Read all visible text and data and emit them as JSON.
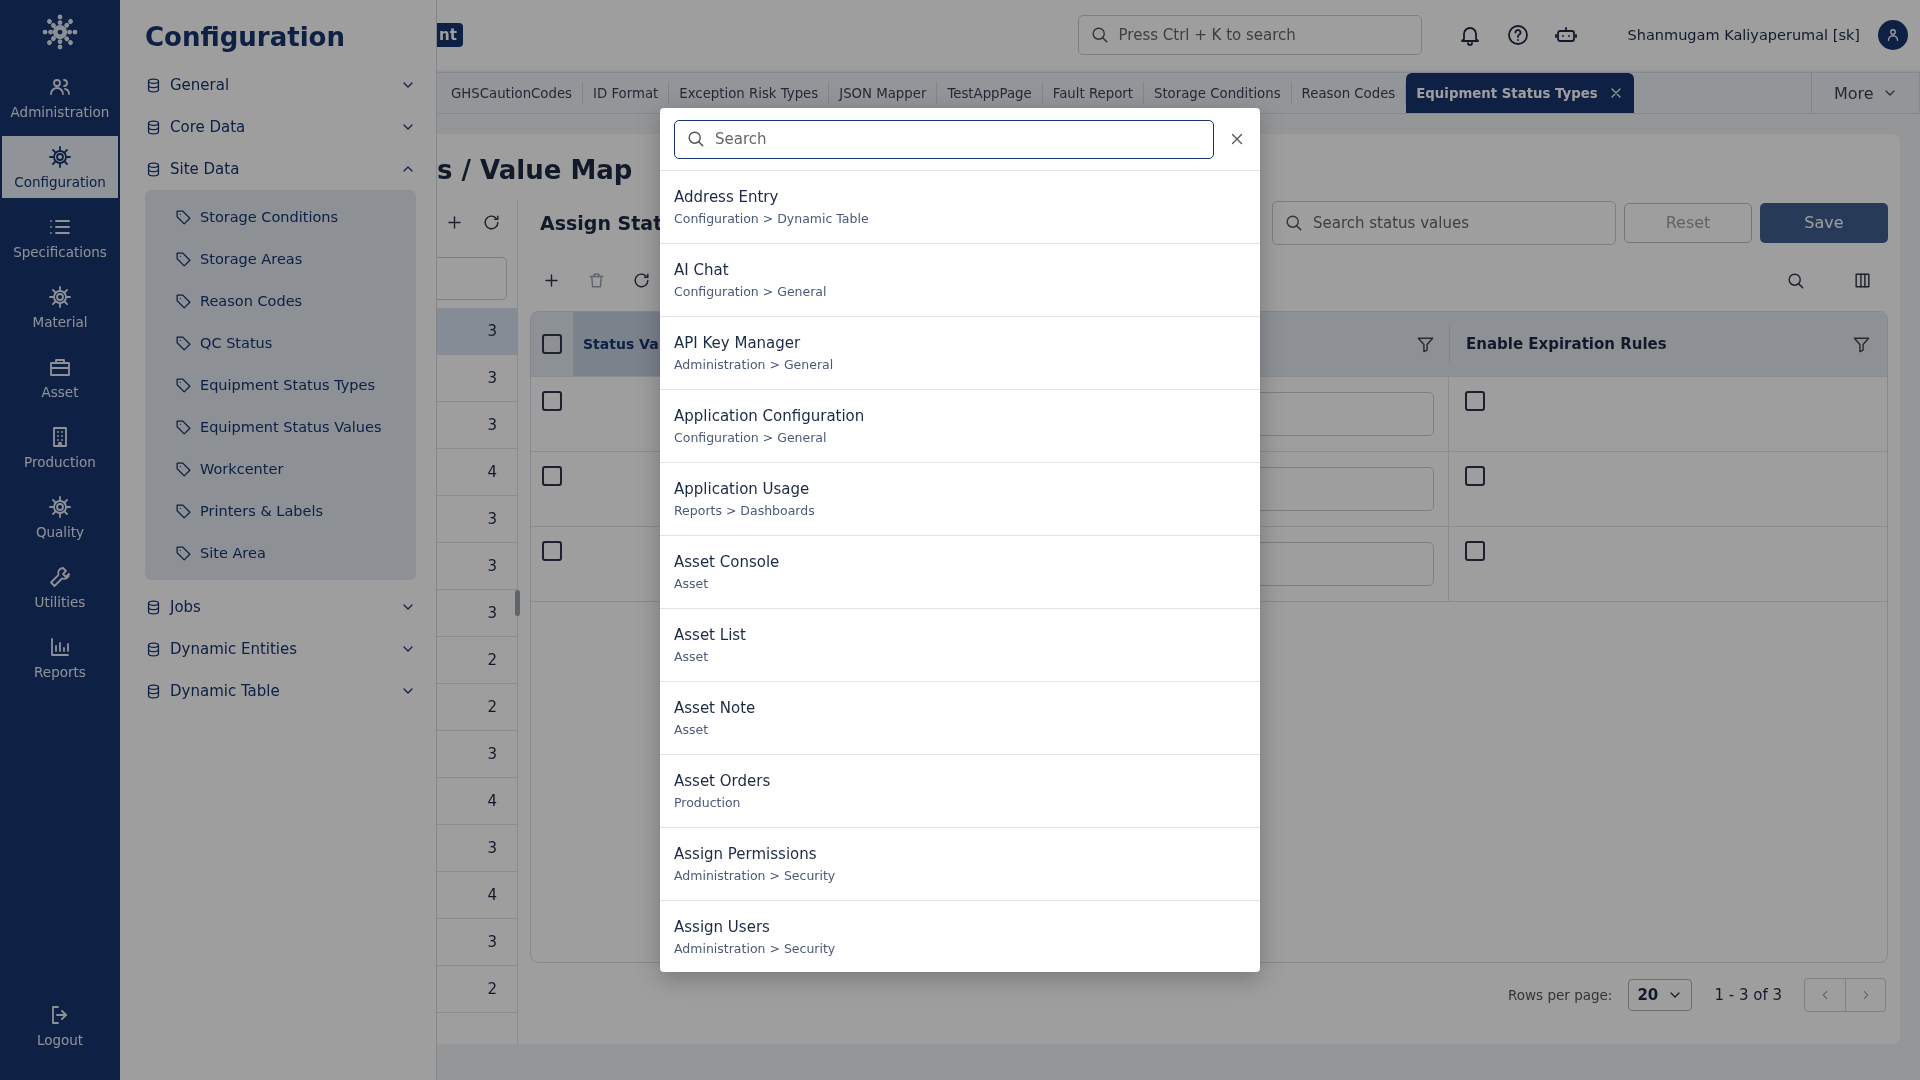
{
  "nav_rail": {
    "items": [
      {
        "label": "Administration",
        "selected": false
      },
      {
        "label": "Configuration",
        "selected": true
      },
      {
        "label": "Specifications",
        "selected": false
      },
      {
        "label": "Material",
        "selected": false
      },
      {
        "label": "Asset",
        "selected": false
      },
      {
        "label": "Production",
        "selected": false
      },
      {
        "label": "Quality",
        "selected": false
      },
      {
        "label": "Utilities",
        "selected": false
      },
      {
        "label": "Reports",
        "selected": false
      }
    ],
    "logout": "Logout"
  },
  "config_panel": {
    "title": "Configuration",
    "sections": [
      {
        "label": "General",
        "expanded": false
      },
      {
        "label": "Core Data",
        "expanded": false
      },
      {
        "label": "Site Data",
        "expanded": true,
        "children": [
          {
            "label": "Storage Conditions"
          },
          {
            "label": "Storage Areas"
          },
          {
            "label": "Reason Codes"
          },
          {
            "label": "QC Status"
          },
          {
            "label": "Equipment Status Types"
          },
          {
            "label": "Equipment Status Values"
          },
          {
            "label": "Workcenter"
          },
          {
            "label": "Printers & Labels"
          },
          {
            "label": "Site Area"
          }
        ]
      },
      {
        "label": "Jobs",
        "expanded": false
      },
      {
        "label": "Dynamic Entities",
        "expanded": false
      },
      {
        "label": "Dynamic Table",
        "expanded": false
      }
    ]
  },
  "header": {
    "badge": "nt",
    "search": {
      "placeholder": "Press Ctrl + K to search"
    },
    "user": "Shanmugam Kaliyaperumal [sk]"
  },
  "tabs": [
    {
      "label": "GHSCautionCodes",
      "selected": false
    },
    {
      "label": "ID Format",
      "selected": false
    },
    {
      "label": "Exception Risk Types",
      "selected": false
    },
    {
      "label": "JSON Mapper",
      "selected": false
    },
    {
      "label": "TestAppPage",
      "selected": false
    },
    {
      "label": "Fault Report",
      "selected": false
    },
    {
      "label": "Storage Conditions",
      "selected": false
    },
    {
      "label": "Reason Codes",
      "selected": false
    },
    {
      "label": "Equipment Status Types",
      "selected": true
    }
  ],
  "more": "More",
  "page": {
    "heading": "s / Value Map",
    "list": [
      {
        "value": "3",
        "selected": true
      },
      {
        "value": "3",
        "selected": false
      },
      {
        "value": "3",
        "selected": false
      },
      {
        "value": "4",
        "selected": false
      },
      {
        "value": "3",
        "selected": false
      },
      {
        "value": "3",
        "selected": false
      },
      {
        "value": "3",
        "selected": false
      },
      {
        "value": "2",
        "selected": false
      },
      {
        "value": "2",
        "selected": false
      },
      {
        "value": "3",
        "selected": false
      },
      {
        "value": "4",
        "selected": false
      },
      {
        "value": "3",
        "selected": false
      },
      {
        "value": "4",
        "selected": false
      },
      {
        "value": "3",
        "selected": false
      },
      {
        "value": "2",
        "selected": false
      }
    ],
    "assign": {
      "title": "Assign Stat",
      "search": {
        "placeholder": "Search status values"
      },
      "buttons": [
        {
          "label": "Reset",
          "disabled": true
        },
        {
          "label": "Save",
          "disabled": false
        }
      ],
      "table": {
        "header_checked": false,
        "columns": [
          "Status Va",
          "Enable Expiration Rules"
        ],
        "rows": [
          {
            "checked": false,
            "enable_expiration": false
          },
          {
            "checked": false,
            "enable_expiration": false
          },
          {
            "checked": false,
            "enable_expiration": false
          }
        ]
      },
      "pagination": {
        "rows_per_page_label": "Rows per page:",
        "rows_per_page": "20",
        "range": "1 - 3 of 3"
      }
    }
  },
  "search_dialog": {
    "search": {
      "placeholder": "Search"
    },
    "results": [
      {
        "title": "Address Entry",
        "path": "Configuration > Dynamic Table"
      },
      {
        "title": "AI Chat",
        "path": "Configuration > General"
      },
      {
        "title": "API Key Manager",
        "path": "Administration > General"
      },
      {
        "title": "Application Configuration",
        "path": "Configuration > General"
      },
      {
        "title": "Application Usage",
        "path": "Reports > Dashboards"
      },
      {
        "title": "Asset Console",
        "path": "Asset"
      },
      {
        "title": "Asset List",
        "path": "Asset"
      },
      {
        "title": "Asset Note",
        "path": "Asset"
      },
      {
        "title": "Asset Orders",
        "path": "Production"
      },
      {
        "title": "Assign Permissions",
        "path": "Administration > Security"
      },
      {
        "title": "Assign Users",
        "path": "Administration > Security"
      }
    ]
  }
}
